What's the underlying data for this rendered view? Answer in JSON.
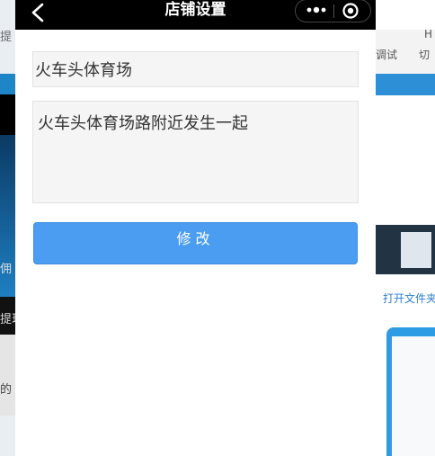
{
  "navbar": {
    "title": "店铺设置",
    "back_icon": "chevron-left-icon",
    "more_icon": "more-dots-icon",
    "close_icon": "target-icon"
  },
  "form": {
    "shop_name": {
      "value": "火车头体育场"
    },
    "shop_address": {
      "value": "火车头体育场路附近发生一起"
    },
    "submit_label": "修改"
  },
  "background": {
    "left_fragments": [
      "提",
      "佣",
      "提现",
      "的"
    ],
    "right_toolbar": [
      "调试",
      "切",
      "H"
    ],
    "right_link": "打开文件夹"
  },
  "colors": {
    "navbar": "#000000",
    "button": "#4b9df2",
    "input_bg": "#f5f5f5"
  }
}
